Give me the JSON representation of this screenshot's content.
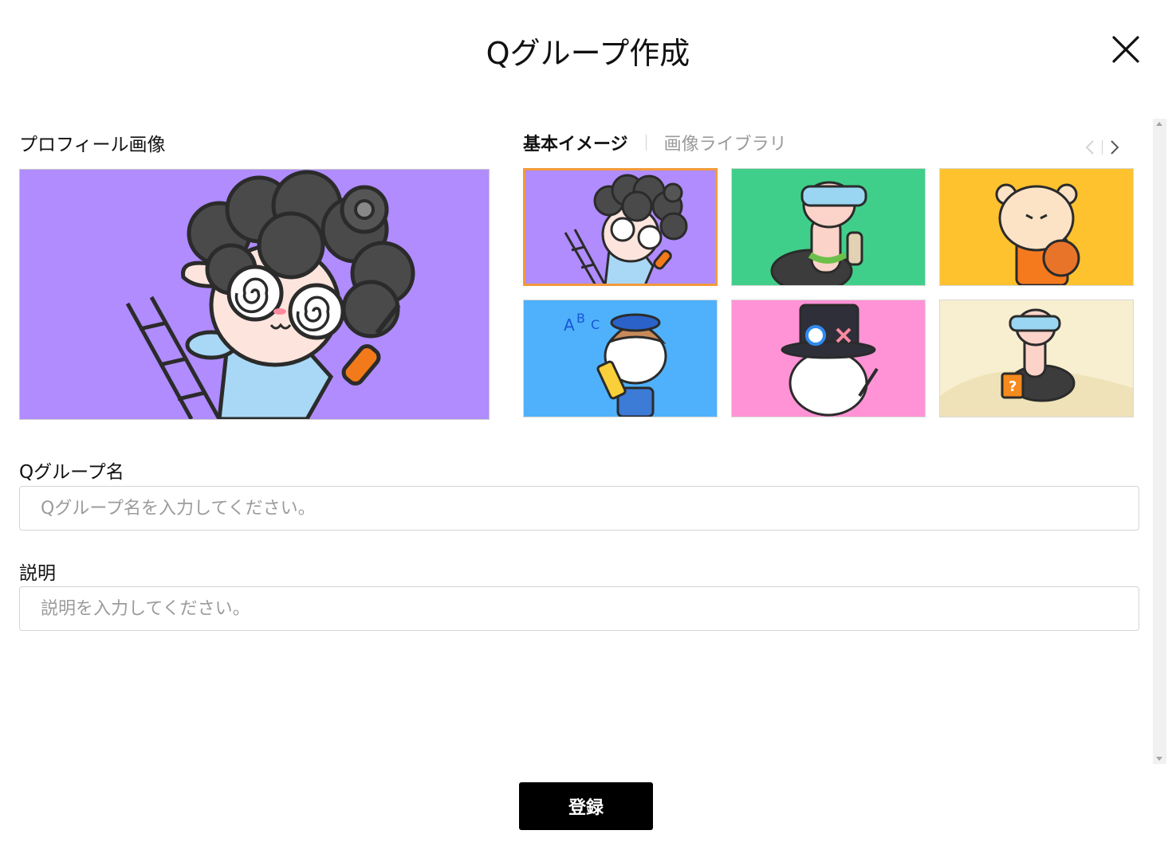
{
  "modal": {
    "title": "Qグループ作成"
  },
  "profile_image": {
    "label": "プロフィール画像"
  },
  "image_tabs": [
    {
      "label": "基本イメージ",
      "active": true
    },
    {
      "label": "画像ライブラリ",
      "active": false
    }
  ],
  "pager_icons": [
    "chevron-left-icon",
    "chevron-right-icon"
  ],
  "thumbnails": [
    {
      "name": "curly-hair-sheep-mechanic",
      "bg": "#b08cff",
      "selected": true
    },
    {
      "name": "ostrich-with-goggles",
      "bg": "#40cf8a",
      "selected": false
    },
    {
      "name": "hamster-basketball",
      "bg": "#fdc22e",
      "selected": false
    },
    {
      "name": "cat-with-pencil",
      "bg": "#4fb1fb",
      "selected": false
    },
    {
      "name": "rabbit-magician",
      "bg": "#ff93d6",
      "selected": false
    },
    {
      "name": "ostrich-question-book",
      "bg": "#f7efcf",
      "selected": false
    }
  ],
  "group_name": {
    "label": "Qグループ名",
    "placeholder": "Qグループ名を入力してください。",
    "value": ""
  },
  "description": {
    "label": "説明",
    "placeholder": "説明を入力してください。",
    "value": ""
  },
  "submit": {
    "label": "登録"
  },
  "colors": {
    "selected_border": "#f29a3a",
    "button_bg": "#000000",
    "placeholder_text": "#9b9b9b"
  }
}
